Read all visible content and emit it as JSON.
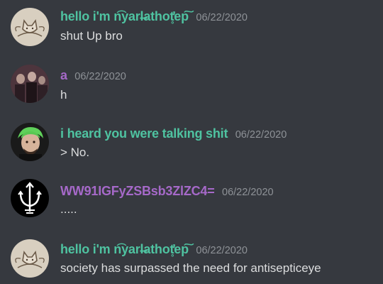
{
  "colors": {
    "background": "#36393f",
    "teal_name": "#4fc3a1",
    "purple_name": "#a669c9",
    "timestamp": "#8e9297",
    "message_text": "#dcddde"
  },
  "messages": [
    {
      "avatar_icon": "cat-sketch-avatar",
      "username": "hello i'm n͡yarl̶athot̥̓ep͠",
      "name_color": "teal",
      "timestamp": "06/22/2020",
      "text": "shut Up bro"
    },
    {
      "avatar_icon": "dark-group-photo-avatar",
      "username": "a",
      "name_color": "purple",
      "timestamp": "06/22/2020",
      "text": "h"
    },
    {
      "avatar_icon": "green-hair-person-avatar",
      "username": "i heard you were talking shit",
      "name_color": "teal",
      "timestamp": "06/22/2020",
      "text": "> No."
    },
    {
      "avatar_icon": "trident-symbol-avatar",
      "username": "WW91IGFyZSBsb3ZlZC4=",
      "name_color": "purple",
      "timestamp": "06/22/2020",
      "text": "....."
    },
    {
      "avatar_icon": "cat-sketch-avatar",
      "username": "hello i'm n͡yarl̶athot̥̓ep͠",
      "name_color": "teal",
      "timestamp": "06/22/2020",
      "text": "society has surpassed the need for antisepticeye"
    }
  ]
}
